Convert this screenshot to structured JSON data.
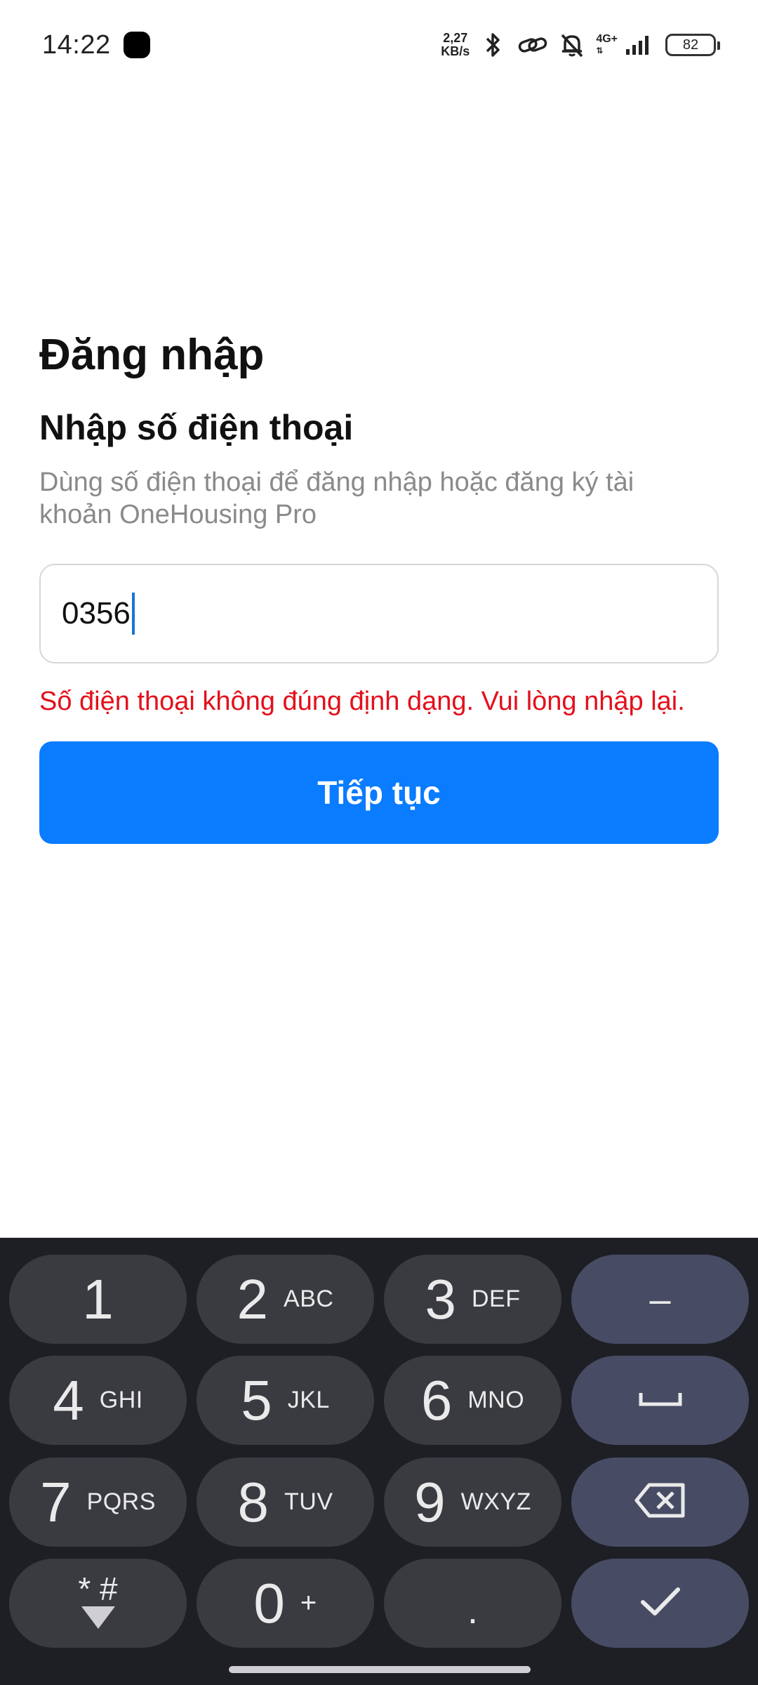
{
  "status_bar": {
    "time": "14:22",
    "net_speed_value": "2,27",
    "net_speed_unit": "KB/s",
    "network_type": "4G+",
    "battery": "82"
  },
  "login": {
    "title": "Đăng nhập",
    "subtitle": "Nhập số điện thoại",
    "description": "Dùng số điện thoại để đăng nhập hoặc đăng ký tài khoản OneHousing Pro",
    "phone_value": "0356",
    "error": "Số điện thoại không đúng định dạng. Vui lòng nhập lại.",
    "continue_label": "Tiếp tục"
  },
  "colors": {
    "primary": "#0a7cff",
    "error": "#e3101b",
    "keyboard_bg": "#1e1f24",
    "key_bg": "#3a3b41",
    "func_key_bg": "#474c64"
  },
  "keyboard": {
    "keys": [
      {
        "digit": "1",
        "letters": ""
      },
      {
        "digit": "2",
        "letters": "ABC"
      },
      {
        "digit": "3",
        "letters": "DEF"
      },
      {
        "digit": "4",
        "letters": "GHI"
      },
      {
        "digit": "5",
        "letters": "JKL"
      },
      {
        "digit": "6",
        "letters": "MNO"
      },
      {
        "digit": "7",
        "letters": "PQRS"
      },
      {
        "digit": "8",
        "letters": "TUV"
      },
      {
        "digit": "9",
        "letters": "WXYZ"
      },
      {
        "digit": "0",
        "letters": "+"
      }
    ],
    "star_hash": "* #",
    "dot": ".",
    "minus": "–",
    "icons": [
      "space-icon",
      "backspace-icon",
      "checkmark-icon",
      "keyboard-hide-icon"
    ]
  }
}
